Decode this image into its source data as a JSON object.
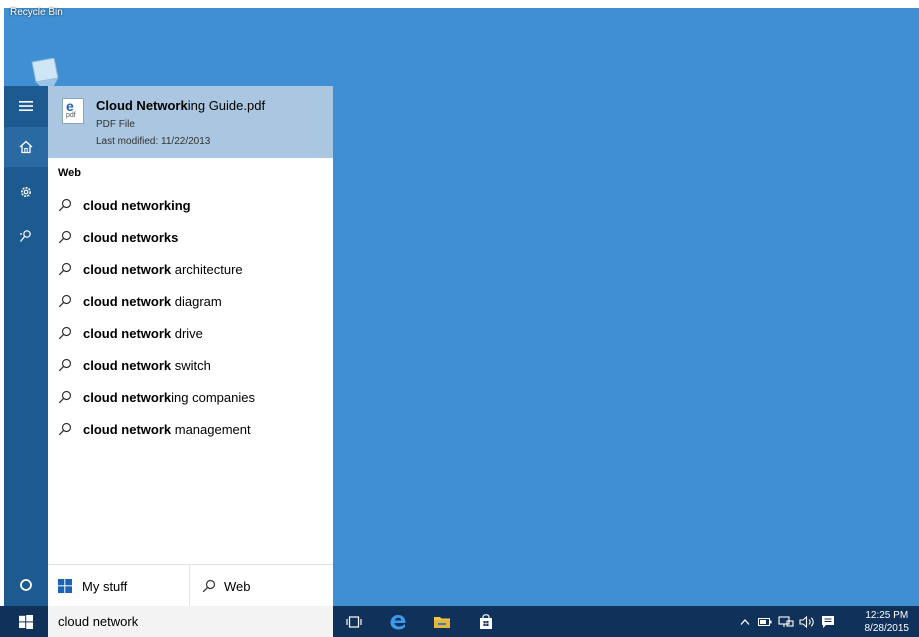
{
  "desktop": {
    "recycle_bin_label": "Recycle Bin",
    "background_color": "#3f8fd2"
  },
  "rail": {
    "items": [
      {
        "name": "menu",
        "icon": "hamburger-icon"
      },
      {
        "name": "home",
        "icon": "home-icon"
      },
      {
        "name": "settings",
        "icon": "gear-icon"
      },
      {
        "name": "feedback",
        "icon": "feedback-icon"
      },
      {
        "name": "cortana",
        "icon": "cortana-circle-icon"
      }
    ]
  },
  "best_match": {
    "title_bold": "Cloud Network",
    "title_rest": "ing Guide.pdf",
    "type": "PDF File",
    "modified": "Last modified: 11/22/2013",
    "icon_e": "e",
    "icon_pdf": "pdf"
  },
  "web_section": {
    "heading": "Web",
    "suggestions": [
      {
        "bold": "cloud networking",
        "rest": ""
      },
      {
        "bold": "cloud networks",
        "rest": ""
      },
      {
        "bold": "cloud network",
        "rest": " architecture"
      },
      {
        "bold": "cloud network",
        "rest": " diagram"
      },
      {
        "bold": "cloud network",
        "rest": " drive"
      },
      {
        "bold": "cloud network",
        "rest": " switch"
      },
      {
        "bold": "cloud network",
        "rest": "ing companies"
      },
      {
        "bold": "cloud network",
        "rest": " management"
      }
    ]
  },
  "footer": {
    "my_stuff_label": "My stuff",
    "web_label": "Web"
  },
  "search": {
    "value": "cloud network"
  },
  "clock": {
    "time": "12:25 PM",
    "date": "8/28/2015"
  },
  "colors": {
    "taskbar": "#10315a",
    "rail": "#1d5a8f",
    "highlight": "#aac6e0"
  }
}
